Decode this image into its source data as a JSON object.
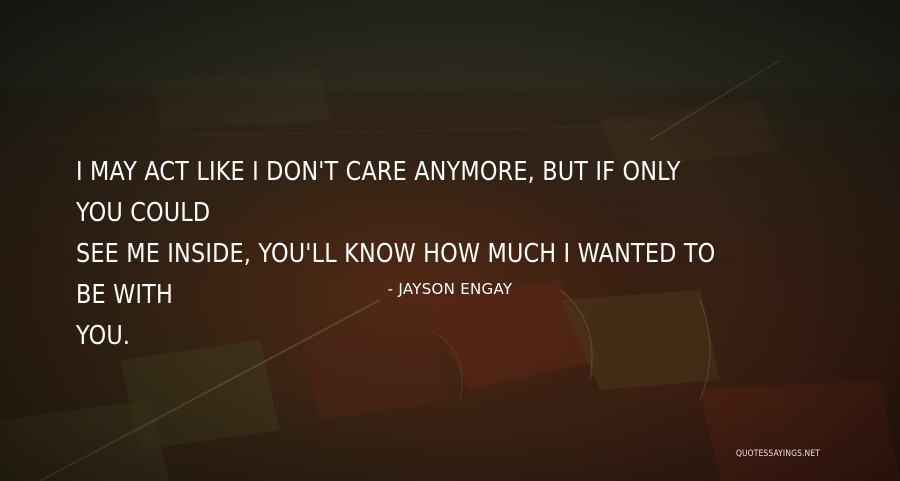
{
  "quote": {
    "line1": "I MAY ACT LIKE I DON'T CARE ANYMORE, BUT IF ONLY YOU COULD",
    "line2": "SEE ME INSIDE, YOU'LL KNOW HOW MUCH I WANTED TO BE WITH",
    "line3": "YOU."
  },
  "author": "- JAYSON ENGAY",
  "watermark": "QUOTESSAYINGS.NET",
  "colors": {
    "text": "#ffffff",
    "background": "#2a2118",
    "field_red": "#6a2a18",
    "field_green": "#3a3a22"
  }
}
